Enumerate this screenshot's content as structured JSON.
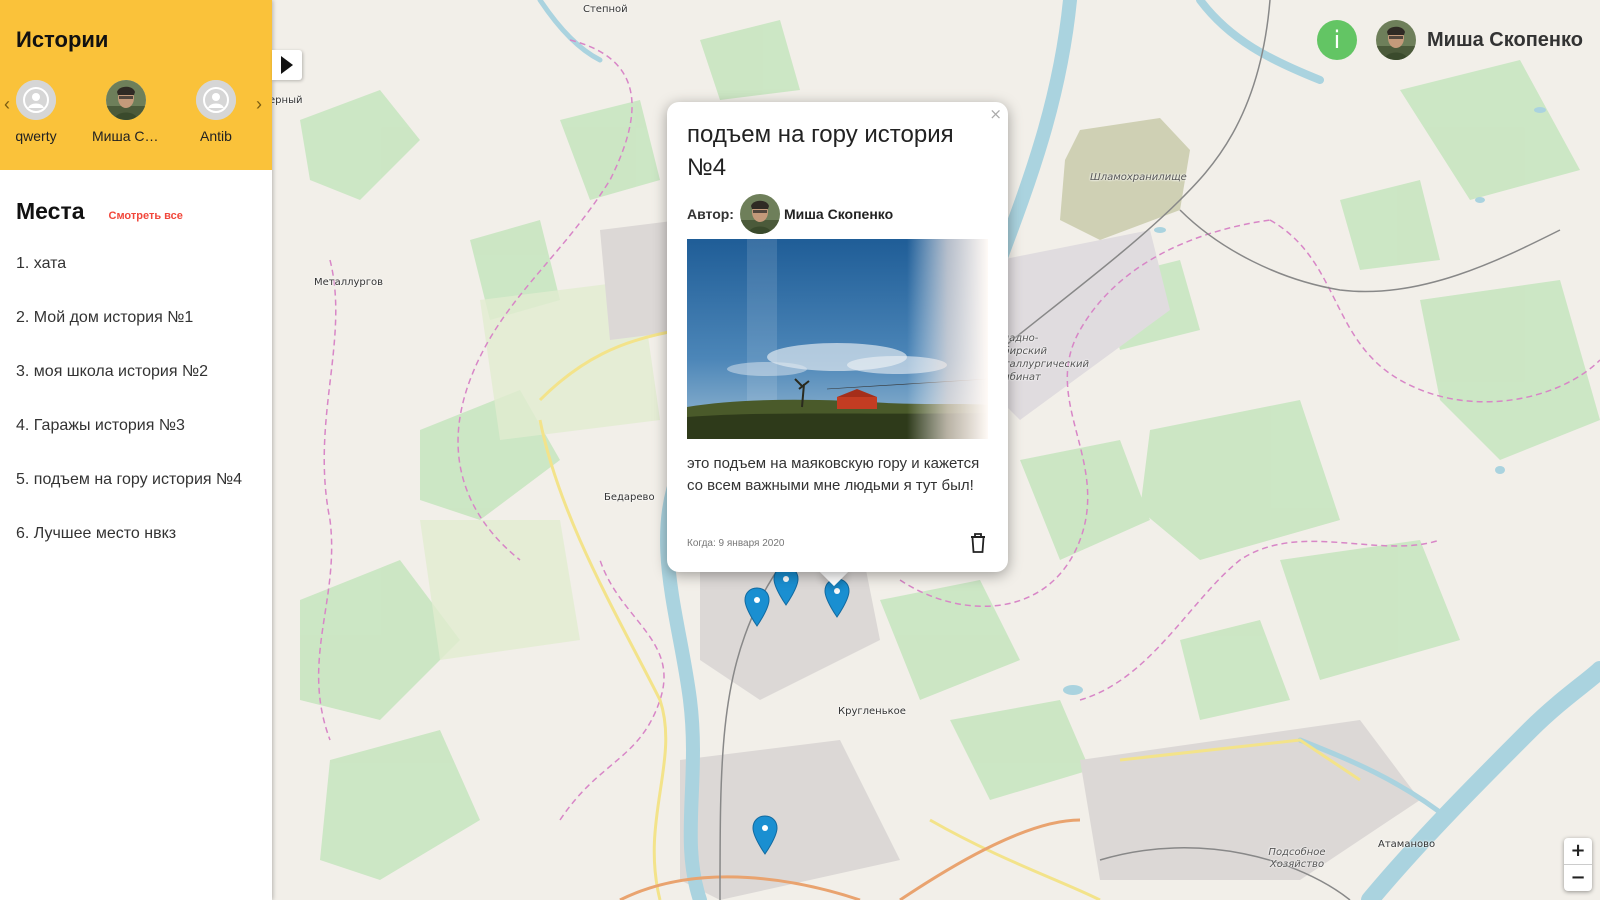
{
  "stories": {
    "title": "Истории",
    "prev_icon": "‹",
    "next_icon": "›",
    "items": [
      {
        "name": "qwerty",
        "avatar": "default-user"
      },
      {
        "name": "Миша Скопенко",
        "avatar": "photo"
      },
      {
        "name": "Antib",
        "avatar": "default-user"
      }
    ]
  },
  "places": {
    "title": "Места",
    "see_all": "Смотреть все",
    "items": [
      "1. хата",
      "2. Мой дом история №1",
      "3. моя школа история №2",
      "4. Гаражы история №3",
      "5. подъем на гору история №4",
      "6. Лучшее место нвкз"
    ]
  },
  "header": {
    "info_icon": "i",
    "user_name": "Миша Скопенко"
  },
  "popup": {
    "close": "×",
    "title": "подъем на гору история №4",
    "author_label": "Автор:",
    "author_name": "Миша Скопенко",
    "text": "это подъем на маяковскую гору и кажется со всем важными мне людьми я тут был!",
    "date": "Когда: 9 января 2020"
  },
  "map": {
    "labels": [
      {
        "text": "Степной",
        "italic": false
      },
      {
        "text": "Северный",
        "italic": false
      },
      {
        "text": "Металлургов",
        "italic": false
      },
      {
        "text": "Шламохранилище",
        "italic": true
      },
      {
        "text": "Западно-Сибирский металлургический комбинат",
        "italic": true
      },
      {
        "text": "Бедарево",
        "italic": false
      },
      {
        "text": "Кругленькое",
        "italic": false
      },
      {
        "text": "Атаманово",
        "italic": false
      },
      {
        "text": "Подсобное Хозяйство",
        "italic": true
      }
    ],
    "marker_color": "#1a8fd1"
  },
  "zoom": {
    "in": "+",
    "out": "−"
  }
}
